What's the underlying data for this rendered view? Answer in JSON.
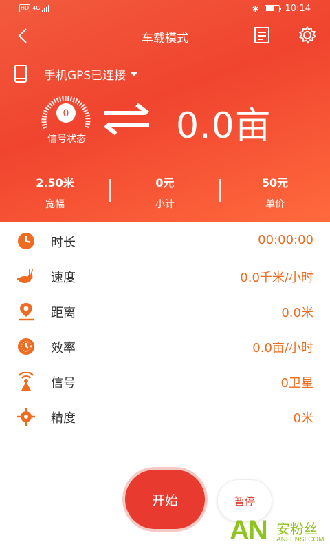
{
  "status_bar": {
    "hd": "HD",
    "network": "4G",
    "time": "10:14",
    "battery_level": 0.6
  },
  "topbar": {
    "title": "车载模式"
  },
  "gps": {
    "label": "手机GPS已连接"
  },
  "signal": {
    "gauge_value": "0",
    "label": "信号状态"
  },
  "area": {
    "value": "0.0亩"
  },
  "stats": [
    {
      "value": "2.50米",
      "label": "宽幅"
    },
    {
      "value": "0元",
      "label": "小计"
    },
    {
      "value": "50元",
      "label": "单价"
    }
  ],
  "rows": [
    {
      "icon": "clock-icon",
      "name": "时长",
      "value": "00:00:00"
    },
    {
      "icon": "rabbit-icon",
      "name": "速度",
      "value": "0.0千米/小时"
    },
    {
      "icon": "location-pin-icon",
      "name": "距离",
      "value": "0.0米"
    },
    {
      "icon": "efficiency-clock-icon",
      "name": "效率",
      "value": "0.0亩/小时"
    },
    {
      "icon": "signal-tower-icon",
      "name": "信号",
      "value": "0卫星"
    },
    {
      "icon": "crosshair-icon",
      "name": "精度",
      "value": "0米"
    }
  ],
  "buttons": {
    "start": "开始",
    "pause": "暂停"
  },
  "watermark": {
    "logo": "AN",
    "name": "安粉丝",
    "url": "ANFENSI.COM"
  },
  "colors": {
    "header_gradient_start": "#f25b3d",
    "header_gradient_end": "#ff6a3d",
    "accent_orange": "#ef6b1f",
    "start_red": "#e83a2e",
    "watermark_green": "#8fc31f"
  }
}
